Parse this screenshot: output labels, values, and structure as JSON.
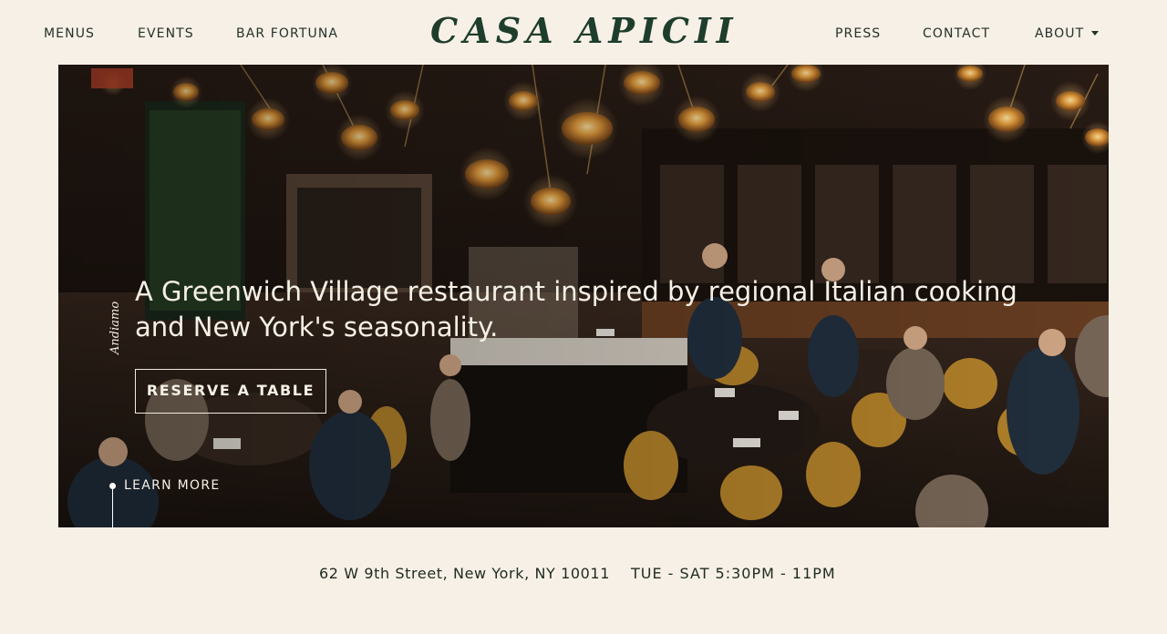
{
  "nav_left": [
    {
      "label": "MENUS"
    },
    {
      "label": "EVENTS"
    },
    {
      "label": "BAR FORTUNA"
    }
  ],
  "logo": "CASA APICII",
  "nav_right": [
    {
      "label": "PRESS"
    },
    {
      "label": "CONTACT"
    },
    {
      "label": "ABOUT"
    }
  ],
  "hero": {
    "tagline": "Andiamo",
    "headline": "A Greenwich Village restaurant inspired by regional Italian cooking and New York's seasonality.",
    "cta_label": "RESERVE A TABLE",
    "learn_more_label": "LEARN MORE",
    "photo_icon": "restaurant-dining-room-photo"
  },
  "info": {
    "address": "62 W 9th Street, New York, NY 10011",
    "hours": "TUE - SAT 5:30PM - 11PM"
  },
  "colors": {
    "background": "#f7f0e6",
    "logo_green": "#1e3d2d",
    "text_dark": "#1f2a21",
    "hero_text": "#f6f1e6"
  }
}
